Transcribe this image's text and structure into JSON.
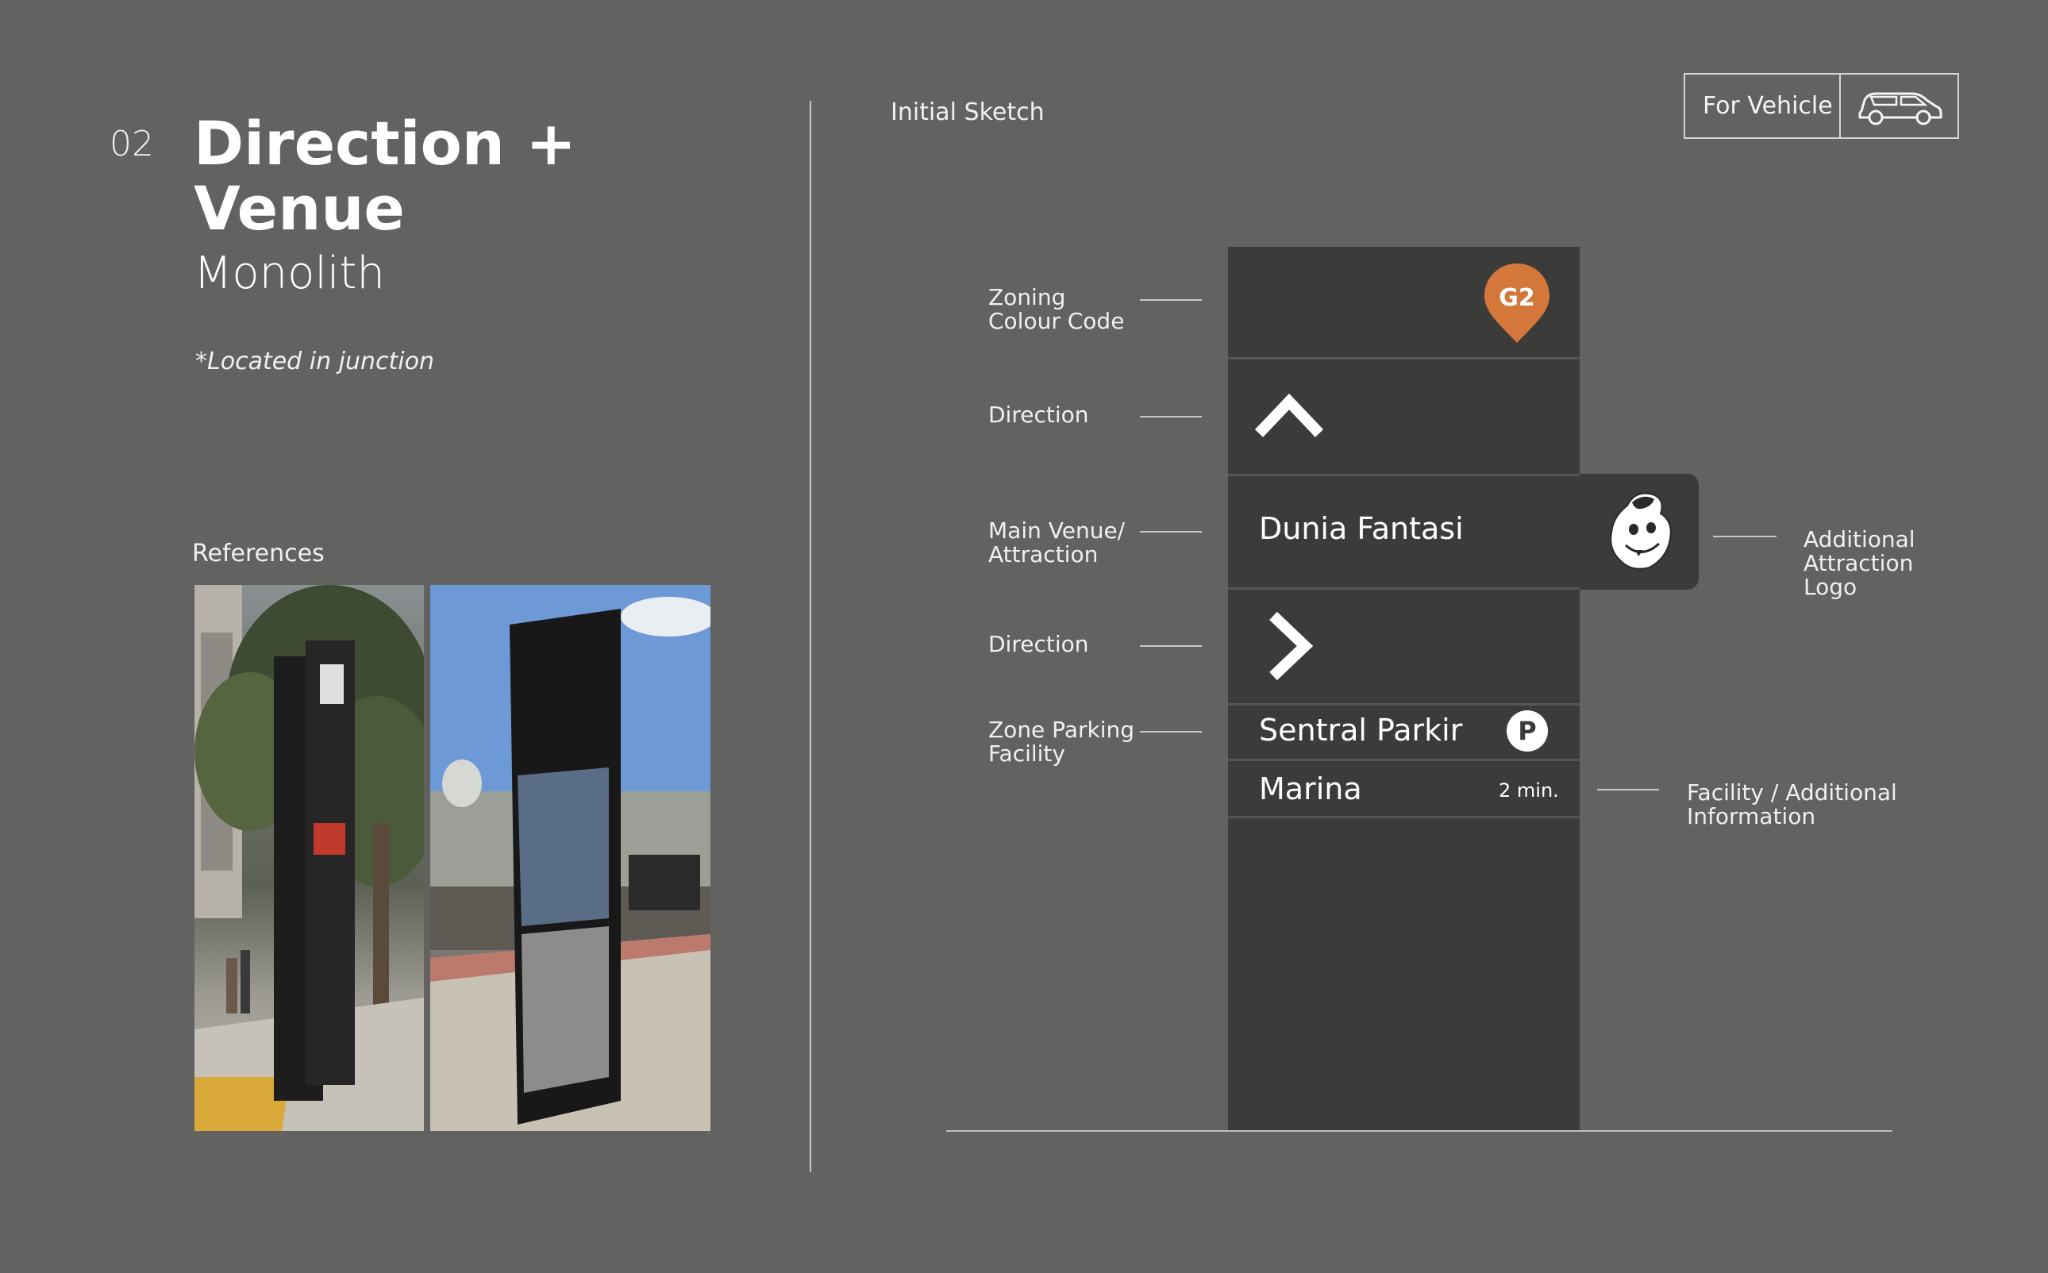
{
  "section": {
    "number": "02",
    "title_line1": "Direction +",
    "title_line2": "Venue",
    "subtitle": "Monolith",
    "note": "*Located in junction"
  },
  "references": {
    "label": "References"
  },
  "sketch": {
    "label": "Initial Sketch"
  },
  "vehicle_tag": {
    "label": "For Vehicle",
    "icon": "car-icon"
  },
  "callouts": {
    "zoning_line1": "Zoning",
    "zoning_line2": "Colour Code",
    "direction1": "Direction",
    "main_venue_line1": "Main Venue/",
    "main_venue_line2": "Attraction",
    "direction2": "Direction",
    "zone_parking_line1": "Zone Parking",
    "zone_parking_line2": "Facility",
    "additional_line1": "Additional",
    "additional_line2": "Attraction",
    "additional_line3": "Logo",
    "facility_line1": "Facility / Additional",
    "facility_line2": "Information"
  },
  "monolith": {
    "zone_code": "G2",
    "zone_color": "#d4773a",
    "venue": "Dunia Fantasi",
    "parking": "Sentral Parkir",
    "parking_icon_letter": "P",
    "destination": "Marina",
    "destination_time": "2 min.",
    "panel_color": "#3b3b3a",
    "arrow_up_icon": "chevron-up-icon",
    "arrow_right_icon": "chevron-right-icon",
    "logo_icon": "mascot-logo-icon"
  }
}
